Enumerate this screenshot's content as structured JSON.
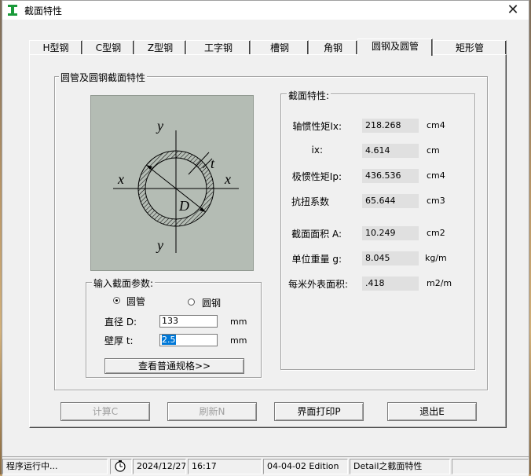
{
  "window": {
    "title": "截面特性"
  },
  "tabs": [
    {
      "label": "H型钢"
    },
    {
      "label": "C型钢"
    },
    {
      "label": "Z型钢"
    },
    {
      "label": "工字钢"
    },
    {
      "label": "槽钢"
    },
    {
      "label": "角钢"
    },
    {
      "label": "圆钢及圆管"
    },
    {
      "label": "矩形管"
    }
  ],
  "active_tab": "圆钢及圆管",
  "section_group": {
    "label": "圆管及圆钢截面特性"
  },
  "figure": {
    "y_top": "y",
    "y_bottom": "y",
    "x_left": "x",
    "x_right": "x",
    "t_label": "t",
    "d_label": "D"
  },
  "properties": {
    "label": "截面特性:",
    "items": [
      {
        "label": "轴惯性矩Ix:",
        "value": "218.268",
        "unit": "cm4"
      },
      {
        "label": "ix:",
        "value": "4.614",
        "unit": "cm"
      },
      {
        "label": "极惯性矩Ip:",
        "value": "436.536",
        "unit": "cm4"
      },
      {
        "label": "抗扭系数",
        "value": "65.644",
        "unit": "cm3"
      },
      {
        "label": "截面面积 A:",
        "value": "10.249",
        "unit": "cm2"
      },
      {
        "label": "单位重量 g:",
        "value": "8.045",
        "unit": "kg/m"
      },
      {
        "label": "每米外表面积:",
        "value": ".418",
        "unit": "m2/m"
      }
    ]
  },
  "input": {
    "label": "输入截面参数:",
    "radio_pipe": "圆管",
    "radio_bar": "圆钢",
    "diameter_label": "直径 D:",
    "diameter_value": "133",
    "diameter_unit": "mm",
    "thickness_label": "壁厚 t:",
    "thickness_value": "2.5",
    "thickness_unit": "mm",
    "spec_button": "查看普通规格>>"
  },
  "buttons": {
    "calc": "计算C",
    "refresh": "刷新N",
    "print": "界面打印P",
    "exit": "退出E"
  },
  "status": {
    "state": "程序运行中...",
    "date": "2024/12/27",
    "time": "16:17",
    "edition": "04-04-02 Edition",
    "module": "Detail之截面特性"
  }
}
